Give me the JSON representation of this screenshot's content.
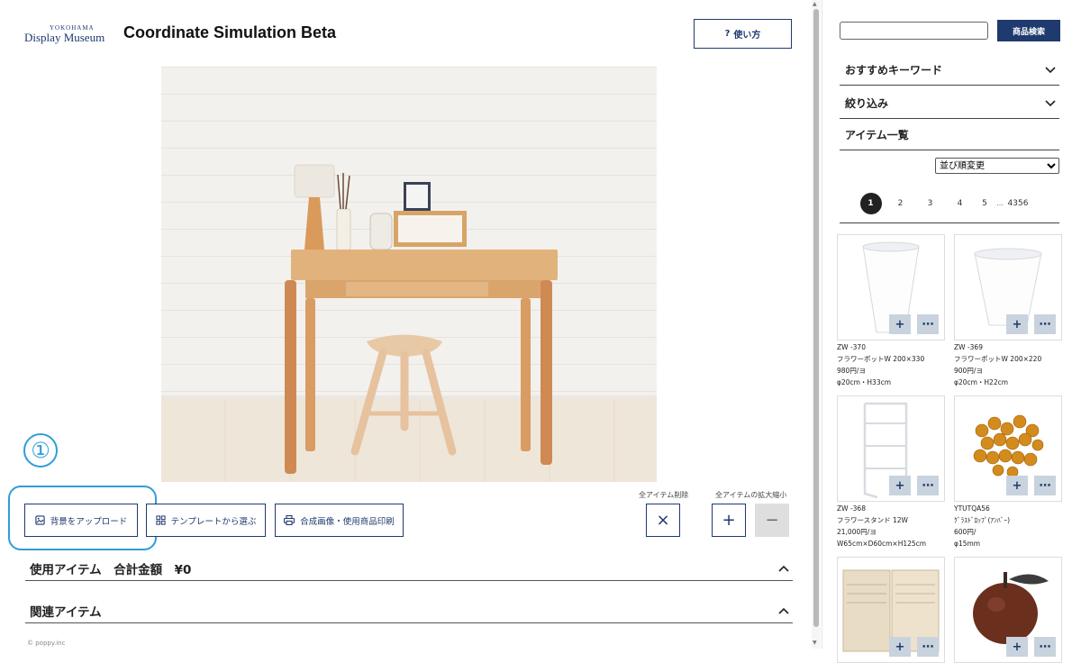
{
  "header": {
    "logo_top": "YOKOHAMA",
    "logo_main": "Display Museum",
    "title": "Coordinate Simulation Beta",
    "howto_icon": "?",
    "howto_label": "使い方"
  },
  "annotation": {
    "step_marker": "①"
  },
  "toolbar": {
    "upload_label": "背景をアップロード",
    "template_label": "テンプレートから選ぶ",
    "print_label": "合成画像・使用商品印刷",
    "delete_all_caption": "全アイテム削除",
    "zoom_all_caption": "全アイテムの拡大縮小",
    "delete_symbol": "×",
    "zoom_in_symbol": "+",
    "zoom_out_symbol": "−"
  },
  "accordions": {
    "used_items": "使用アイテム　合計金額　¥0",
    "related_items": "関連アイテム"
  },
  "footer": {
    "copyright": "© poppy.inc"
  },
  "sidebar": {
    "search_placeholder": "",
    "search_button": "商品検索",
    "keywords_label": "おすすめキーワード",
    "filter_label": "絞り込み",
    "items_label": "アイテム一覧",
    "sort_selected": "並び順変更",
    "pages": [
      "1",
      "2",
      "3",
      "4",
      "5"
    ],
    "pages_ellipsis": "…",
    "pages_last": "4356",
    "products": [
      {
        "code": "ZW -370",
        "name": "フラワーポットW 200×330",
        "price": "980円/ヨ",
        "size": "φ20cm・H33cm",
        "icon": "white-flower-pot"
      },
      {
        "code": "ZW -369",
        "name": "フラワーポットW 200×220",
        "price": "900円/ヨ",
        "size": "φ20cm・H22cm",
        "icon": "white-flower-pot"
      },
      {
        "code": "ZW -368",
        "name": "フラワースタンド 12W",
        "price": "21,000円/ヨ",
        "size": "W65cm×D60cm×H125cm",
        "icon": "flower-stand"
      },
      {
        "code": "YTUTQA56",
        "name": "ｸﾞﾗｽﾄﾞﾛｯﾌﾟ(ｱﾝﾊﾞｰ)",
        "price": "600円/",
        "size": "φ15mm",
        "icon": "amber-glass-drops"
      },
      {
        "code": "",
        "name": "",
        "price": "",
        "size": "",
        "icon": "sheet-music-book"
      },
      {
        "code": "",
        "name": "",
        "price": "",
        "size": "",
        "icon": "wooden-apple"
      }
    ],
    "add_symbol": "+",
    "more_symbol": "⋯"
  },
  "colors": {
    "navy": "#1e3a6e",
    "highlight_blue": "#2f9ed8",
    "card_button": "#c9d3de"
  }
}
